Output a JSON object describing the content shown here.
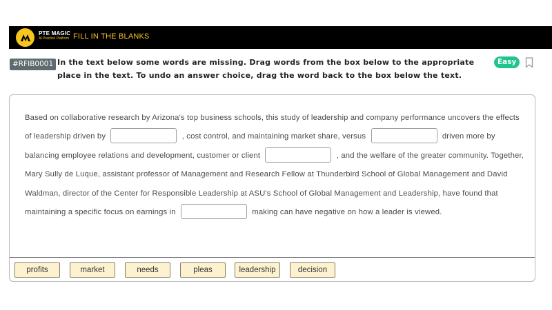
{
  "header": {
    "brand_name": "PTE MAGIC",
    "brand_tagline": "AI Practice Platform",
    "title": "FILL IN THE BLANKS"
  },
  "question": {
    "id": "#RFIB0001",
    "instruction": "In the text below some words are missing. Drag words from the box below to the appropriate place in the text. To undo an answer choice, drag the word back to the box below the text.",
    "difficulty": "Easy",
    "bookmark_icon": "bookmark-icon"
  },
  "passage": {
    "seg1": "Based on collaborative research by Arizona's top business schools, this study of leadership and company performance uncovers the effects of leadership driven by",
    "seg2": ", cost control, and maintaining market share, versus",
    "seg3": "driven more by balancing employee relations and development, customer or client",
    "seg4": ", and the welfare of the greater community. Together, Mary Sully de Luque, assistant professor of Management and Research Fellow at Thunderbird School of Global Management and David Waldman, director of the Center for Responsible Leadership at ASU's School of Global Management and Leadership, have found that maintaining a specific focus on earnings in",
    "seg5": "making can have negative on how a leader is viewed."
  },
  "word_bank": [
    "profits",
    "market",
    "needs",
    "pleas",
    "leadership",
    "decision"
  ],
  "colors": {
    "header_bg": "#000000",
    "accent": "#f7c51e",
    "badge_easy": "#21c48b",
    "word_bg": "#fdf2d0"
  }
}
